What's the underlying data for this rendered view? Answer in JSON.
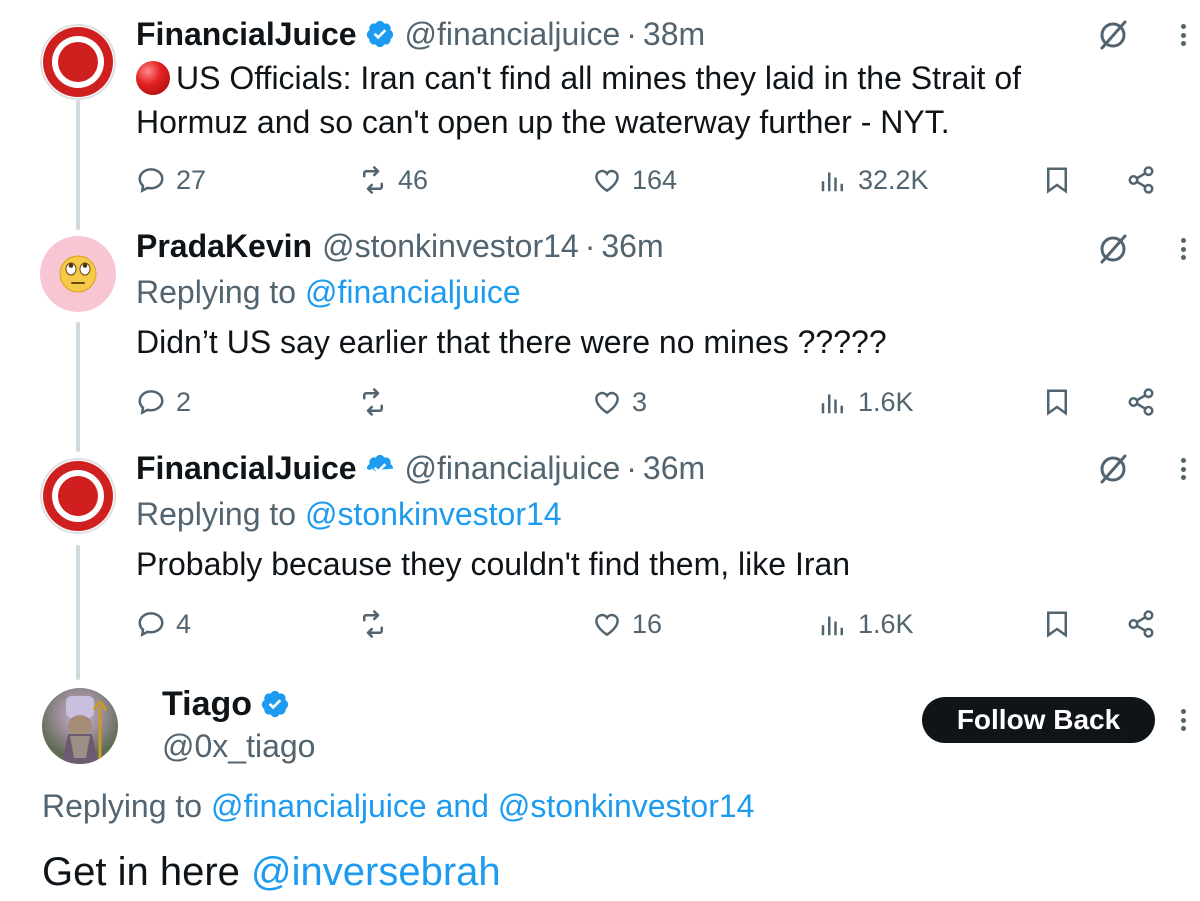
{
  "tweets": [
    {
      "name": "FinancialJuice",
      "handle": "@financialjuice",
      "time": "38m",
      "text": "US Officials: Iran can't find all mines they laid in the Strait of Hormuz and so can't open up the waterway further - NYT.",
      "text_line1": "US Officials: Iran can't find all mines they laid in the Strait of",
      "text_line2": "Hormuz and so can't open up the waterway further - NYT.",
      "replies": "27",
      "reposts": "46",
      "likes": "164",
      "views": "32.2K"
    },
    {
      "name": "PradaKevin",
      "handle": "@stonkinvestor14",
      "time": "36m",
      "replying_label": "Replying to",
      "replying_to": "@financialjuice",
      "text": "Didn’t US say earlier that there were no mines ?????",
      "replies": "2",
      "reposts": "",
      "likes": "3",
      "views": "1.6K"
    },
    {
      "name": "FinancialJuice",
      "handle": "@financialjuice",
      "time": "36m",
      "replying_label": "Replying to",
      "replying_to": "@stonkinvestor14",
      "text": "Probably because they couldn't find them, like Iran",
      "replies": "4",
      "reposts": "",
      "likes": "16",
      "views": "1.6K"
    }
  ],
  "main_reply": {
    "name": "Tiago",
    "handle": "@0x_tiago",
    "follow_label": "Follow Back",
    "replying_label": "Replying to",
    "replying_to_1": "@financialjuice",
    "replying_and": "and",
    "replying_to_2": "@stonkinvestor14",
    "text_prefix": "Get in here",
    "mention": "@inversebrah"
  },
  "separator": "·",
  "icons": {
    "verified": "verified-badge-icon",
    "grok": "grok-icon",
    "more": "more-dots-icon",
    "reply": "reply-icon",
    "repost": "repost-icon",
    "like": "heart-icon",
    "views": "views-icon",
    "bookmark": "bookmark-icon",
    "share": "share-icon",
    "emoji": "rolling-eyes-emoji",
    "red_ball": "red-circle-emoji"
  },
  "colors": {
    "text": "#0f1419",
    "muted": "#536471",
    "link": "#1d9bf0",
    "verified": "#1d9bf0",
    "brand_red": "#d01f1f"
  }
}
